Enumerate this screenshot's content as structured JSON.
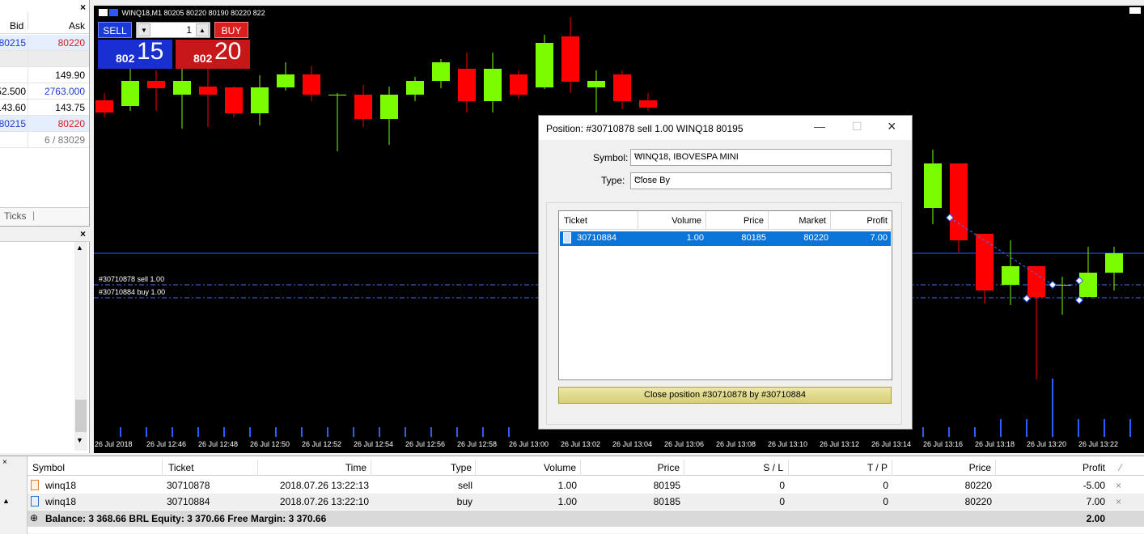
{
  "market_watch": {
    "col_bid": "Bid",
    "col_ask": "Ask",
    "rows": [
      {
        "bid": "80215",
        "ask": "80220",
        "bid_color": "#1a3bd6",
        "ask_color": "#d81e1e",
        "highlight": true
      },
      {
        "bid": "",
        "ask": ""
      },
      {
        "bid": "",
        "ask": "149.90"
      },
      {
        "bid": "52.500",
        "ask": "2763.000",
        "ask_color": "#1a3bd6"
      },
      {
        "bid": "143.60",
        "ask": "143.75"
      },
      {
        "bid": "80215",
        "ask": "80220",
        "bid_color": "#1a3bd6",
        "ask_color": "#d81e1e",
        "highlight": true
      },
      {
        "bid": "",
        "ask": "6 / 83029",
        "ask_color": "#777777"
      }
    ],
    "tab_label": "Ticks"
  },
  "chart": {
    "title": "WINQ18,M1  80205 80220 80190 80220  822",
    "time_labels": [
      "26 Jul 2018",
      "26 Jul 12:46",
      "26 Jul 12:48",
      "26 Jul 12:50",
      "26 Jul 12:52",
      "26 Jul 12:54",
      "26 Jul 12:56",
      "26 Jul 12:58",
      "26 Jul 13:00",
      "26 Jul 13:02",
      "26 Jul 13:04",
      "26 Jul 13:06",
      "26 Jul 13:08",
      "26 Jul 13:10",
      "26 Jul 13:12",
      "26 Jul 13:14",
      "26 Jul 13:16",
      "26 Jul 13:18",
      "26 Jul 13:20",
      "26 Jul 13:22"
    ],
    "order_sell_label": "#30710878 sell 1.00",
    "order_buy_label": "#30710884 buy 1.00",
    "bull_color": "#7cfc00",
    "bear_color": "#ff0000"
  },
  "one_click": {
    "sell_label": "SELL",
    "buy_label": "BUY",
    "volume": "1",
    "sell_small": "802",
    "sell_big": "15",
    "buy_small": "802",
    "buy_big": "20"
  },
  "dialog": {
    "title": "Position: #30710878 sell 1.00 WINQ18 80195",
    "symbol_label": "Symbol:",
    "symbol_value": "WINQ18, IBOVESPA MINI",
    "type_label": "Type:",
    "type_value": "Close By",
    "columns": [
      "Ticket",
      "Volume",
      "Price",
      "Market",
      "Profit"
    ],
    "row": {
      "ticket": "30710884",
      "volume": "1.00",
      "price": "80185",
      "market": "80220",
      "profit": "7.00"
    },
    "close_button": "Close position #30710878 by #30710884"
  },
  "terminal": {
    "columns": [
      "Symbol",
      "Ticket",
      "Time",
      "Type",
      "Volume",
      "Price",
      "S / L",
      "T / P",
      "Price",
      "Profit"
    ],
    "rows": [
      {
        "symbol": "winq18",
        "ticket": "30710878",
        "time": "2018.07.26 13:22:13",
        "type": "sell",
        "volume": "1.00",
        "price": "80195",
        "sl": "0",
        "tp": "0",
        "cur": "80220",
        "profit": "-5.00"
      },
      {
        "symbol": "winq18",
        "ticket": "30710884",
        "time": "2018.07.26 13:22:10",
        "type": "buy",
        "volume": "1.00",
        "price": "80185",
        "sl": "0",
        "tp": "0",
        "cur": "80220",
        "profit": "7.00"
      }
    ],
    "balance_text": "Balance: 3 368.66 BRL  Equity: 3 370.66  Free Margin: 3 370.66",
    "total_profit": "2.00"
  }
}
